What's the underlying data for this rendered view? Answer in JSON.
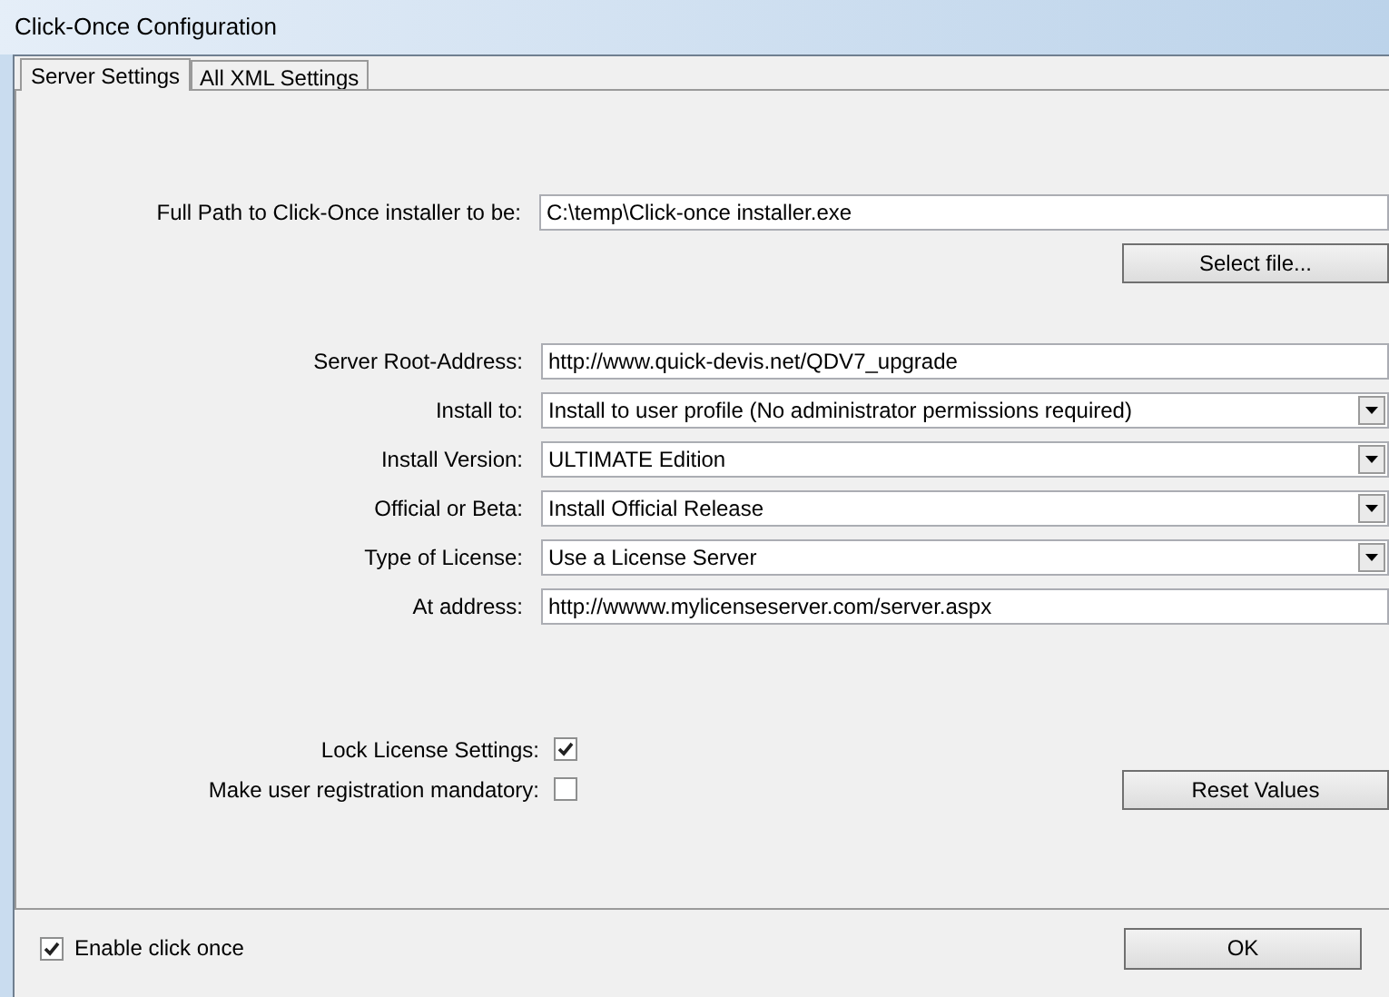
{
  "window": {
    "title": "Click-Once Configuration"
  },
  "tabs": [
    {
      "label": "Server Settings",
      "selected": true
    },
    {
      "label": "All XML Settings",
      "selected": false
    }
  ],
  "installer": {
    "label": "Full Path to Click-Once installer to be:",
    "value": "C:\\temp\\Click-once installer.exe",
    "button": "Select file..."
  },
  "fields": [
    {
      "kind": "text",
      "label": "Server Root-Address:",
      "value": "http://www.quick-devis.net/QDV7_upgrade"
    },
    {
      "kind": "dropdown",
      "label": "Install to:",
      "value": "Install to user profile (No administrator permissions required)"
    },
    {
      "kind": "dropdown",
      "label": "Install Version:",
      "value": "ULTIMATE Edition"
    },
    {
      "kind": "dropdown",
      "label": "Official or Beta:",
      "value": "Install Official Release"
    },
    {
      "kind": "dropdown",
      "label": "Type of License:",
      "value": "Use a License Server"
    },
    {
      "kind": "text",
      "label": "At address:",
      "value": "http://wwww.mylicenseserver.com/server.aspx"
    }
  ],
  "options": [
    {
      "label": "Lock License Settings:",
      "checked": true
    },
    {
      "label": "Make user registration mandatory:",
      "checked": false
    }
  ],
  "reset_button": "Reset Values",
  "enable": {
    "label": "Enable click once",
    "checked": true
  },
  "ok_button": "OK"
}
